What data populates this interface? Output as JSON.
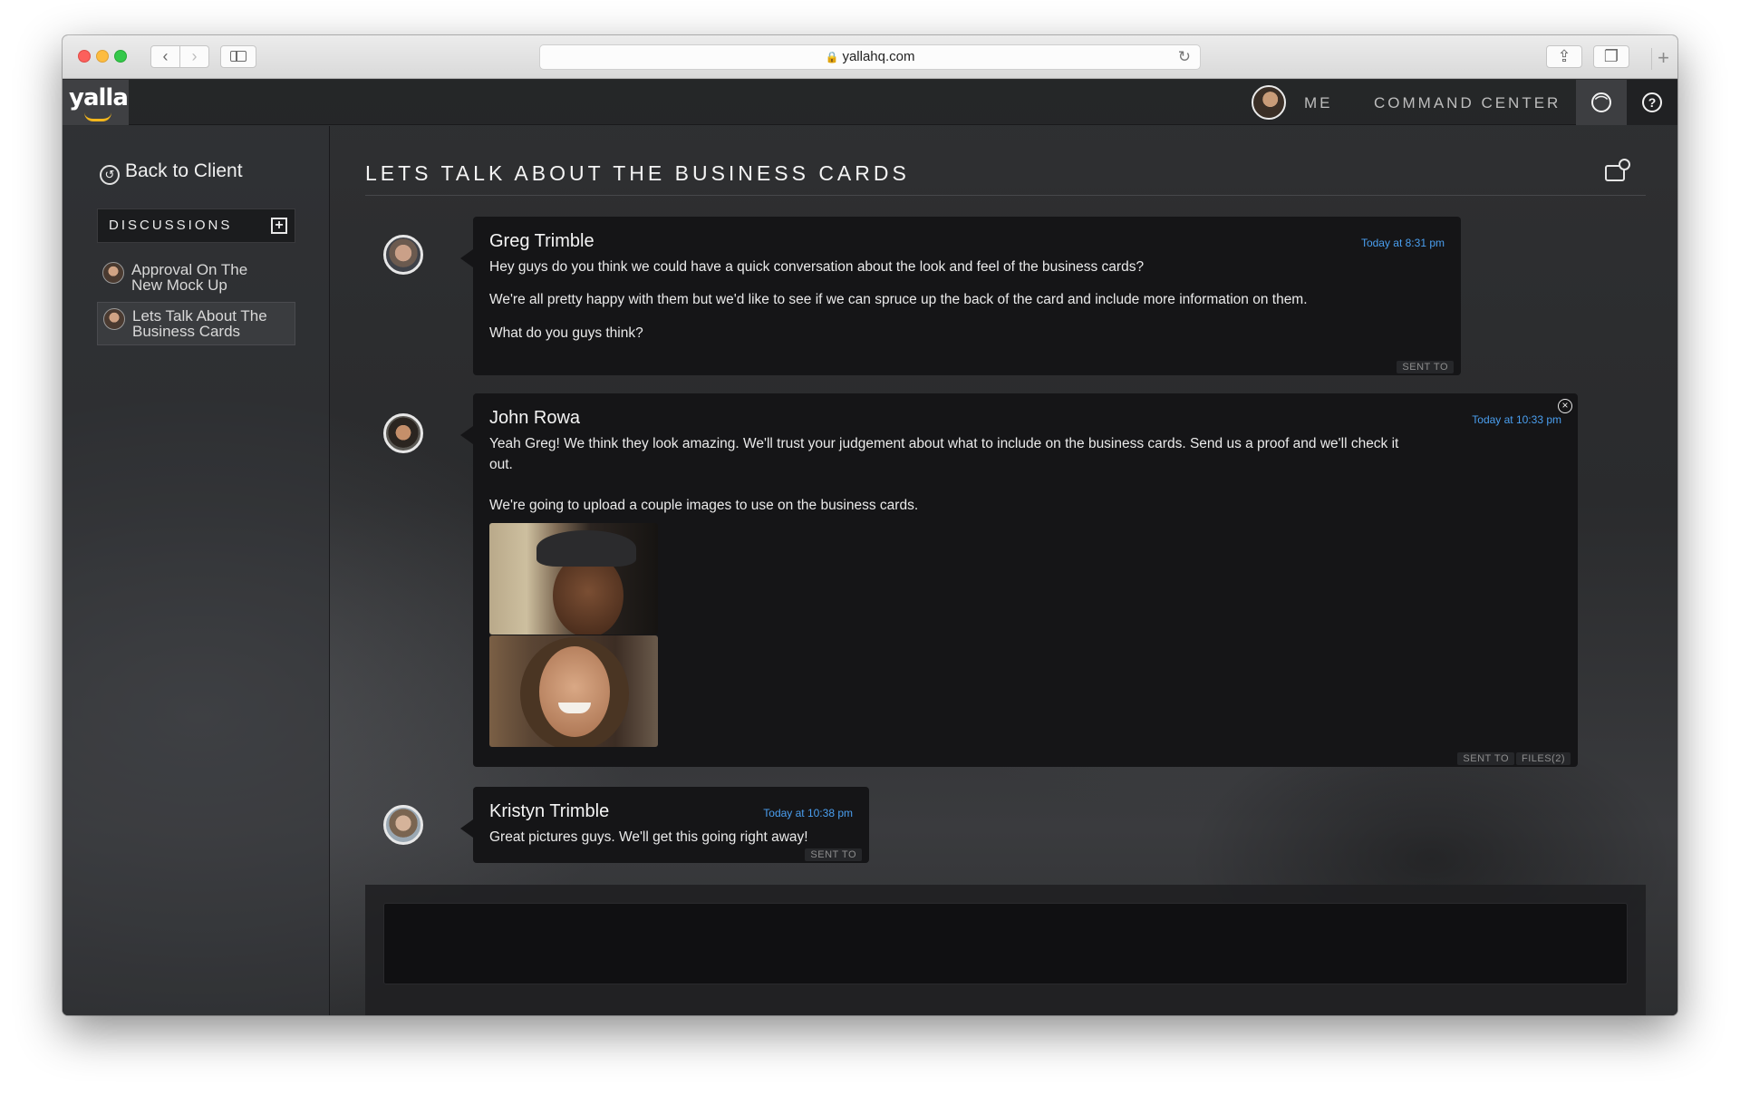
{
  "browser": {
    "url": "yallahq.com"
  },
  "app": {
    "logo_text": "yalla",
    "brand_accent": "#f3b61c"
  },
  "topnav": {
    "me_label": "ME",
    "command_center_label": "COMMAND CENTER"
  },
  "sidebar": {
    "back_label": "Back to Client",
    "discussions_label": "DISCUSSIONS",
    "items": [
      {
        "line1": "Approval On The",
        "line2": "New Mock Up",
        "active": false
      },
      {
        "line1": "Lets Talk About The",
        "line2": "Business Cards",
        "active": true
      }
    ]
  },
  "thread": {
    "title": "LETS TALK ABOUT THE BUSINESS CARDS",
    "messages": [
      {
        "author": "Greg Trimble",
        "time": "Today at 8:31 pm",
        "paragraphs": [
          "Hey guys do you think we could have a quick conversation about the look and feel of the business cards?",
          "We're all pretty happy with them but we'd like to see if we can spruce up the back of the card and include more information on them.",
          "What do you guys think?"
        ],
        "tags": [
          "SENT TO"
        ]
      },
      {
        "author": "John Rowa",
        "time": "Today at 10:33 pm",
        "paragraphs": [
          "Yeah Greg! We think they look amazing. We'll trust your judgement about what to include on the business cards. Send us a proof and we'll check it",
          "out.",
          "We're going to upload a couple images to use on the business cards."
        ],
        "tags": [
          "SENT TO",
          "FILES(2)"
        ]
      },
      {
        "author": "Kristyn Trimble",
        "time": "Today at 10:38 pm",
        "paragraphs": [
          "Great pictures guys. We'll get this going right away!"
        ],
        "tags": [
          "SENT TO"
        ]
      }
    ]
  },
  "composer": {
    "value": ""
  },
  "colors": {
    "timestamp": "#4a9ff0",
    "bubble": "#151517"
  }
}
